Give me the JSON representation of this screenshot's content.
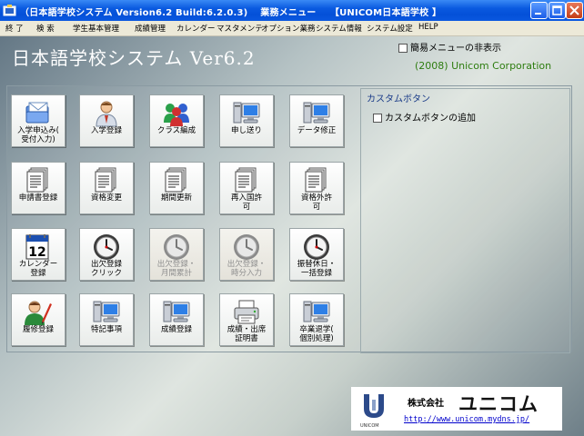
{
  "window": {
    "title": "（日本語学校システム Version6.2 Build:6.2.0.3)　 業務メニュー　　【UNICOM日本語学校 】"
  },
  "menu": [
    "終 了",
    "検 索",
    "学生基本管理",
    "成績管理",
    "カレンダー",
    "マスタメンテ",
    "オプション業務",
    "システム情報",
    "システム設定",
    "HELP"
  ],
  "header": {
    "app_title": "日本語学校システム Ver6.2",
    "simple_menu_label": "簡易メニューの非表示",
    "company_line": "(2008) Unicom Corporation"
  },
  "tiles": [
    {
      "label": "入学申込み(\n受付入力)",
      "icon": "folder-mail-icon",
      "disabled": false
    },
    {
      "label": "入学登録",
      "icon": "person-icon",
      "disabled": false
    },
    {
      "label": "クラス編成",
      "icon": "group-icon",
      "disabled": false
    },
    {
      "label": "申し送り",
      "icon": "computer-icon",
      "disabled": false
    },
    {
      "label": "データ修正",
      "icon": "computer-icon",
      "disabled": false
    },
    {
      "label": "申請書登録",
      "icon": "document-icon",
      "disabled": false
    },
    {
      "label": "資格変更",
      "icon": "document-icon",
      "disabled": false
    },
    {
      "label": "期間更新",
      "icon": "document-icon",
      "disabled": false
    },
    {
      "label": "再入国許\n可",
      "icon": "document-icon",
      "disabled": false
    },
    {
      "label": "資格外許\n可",
      "icon": "document-icon",
      "disabled": false
    },
    {
      "label": "カレンダー\n登録",
      "icon": "calendar-icon",
      "disabled": false
    },
    {
      "label": "出欠登録\nクリック",
      "icon": "clock-icon",
      "disabled": false
    },
    {
      "label": "出欠登録・\n月間累計",
      "icon": "clock-icon",
      "disabled": true
    },
    {
      "label": "出欠登録・\n時分入力",
      "icon": "clock-icon",
      "disabled": true
    },
    {
      "label": "振替休日・\n一括登録",
      "icon": "clock-icon",
      "disabled": false
    },
    {
      "label": "履修登録",
      "icon": "person-pencil-icon",
      "disabled": false
    },
    {
      "label": "特記事項",
      "icon": "computer-icon",
      "disabled": false
    },
    {
      "label": "成績登録",
      "icon": "computer-icon",
      "disabled": false
    },
    {
      "label": "成績・出席\n証明書",
      "icon": "printer-icon",
      "disabled": false
    },
    {
      "label": "卒業退学(\n個別処理)",
      "icon": "computer-icon",
      "disabled": false
    }
  ],
  "custom_panel": {
    "title": "カスタムボタン",
    "add_label": "カスタムボタンの追加"
  },
  "logo": {
    "small_text": "UNICOM",
    "company_prefix": "株式会社",
    "brand": "ユニコム",
    "url": "http://www.unicom.mydns.jp/"
  },
  "colors": {
    "titlebar": "#0a5ae0",
    "company_line": "#2e7d10",
    "custom_title": "#1a3b88"
  }
}
